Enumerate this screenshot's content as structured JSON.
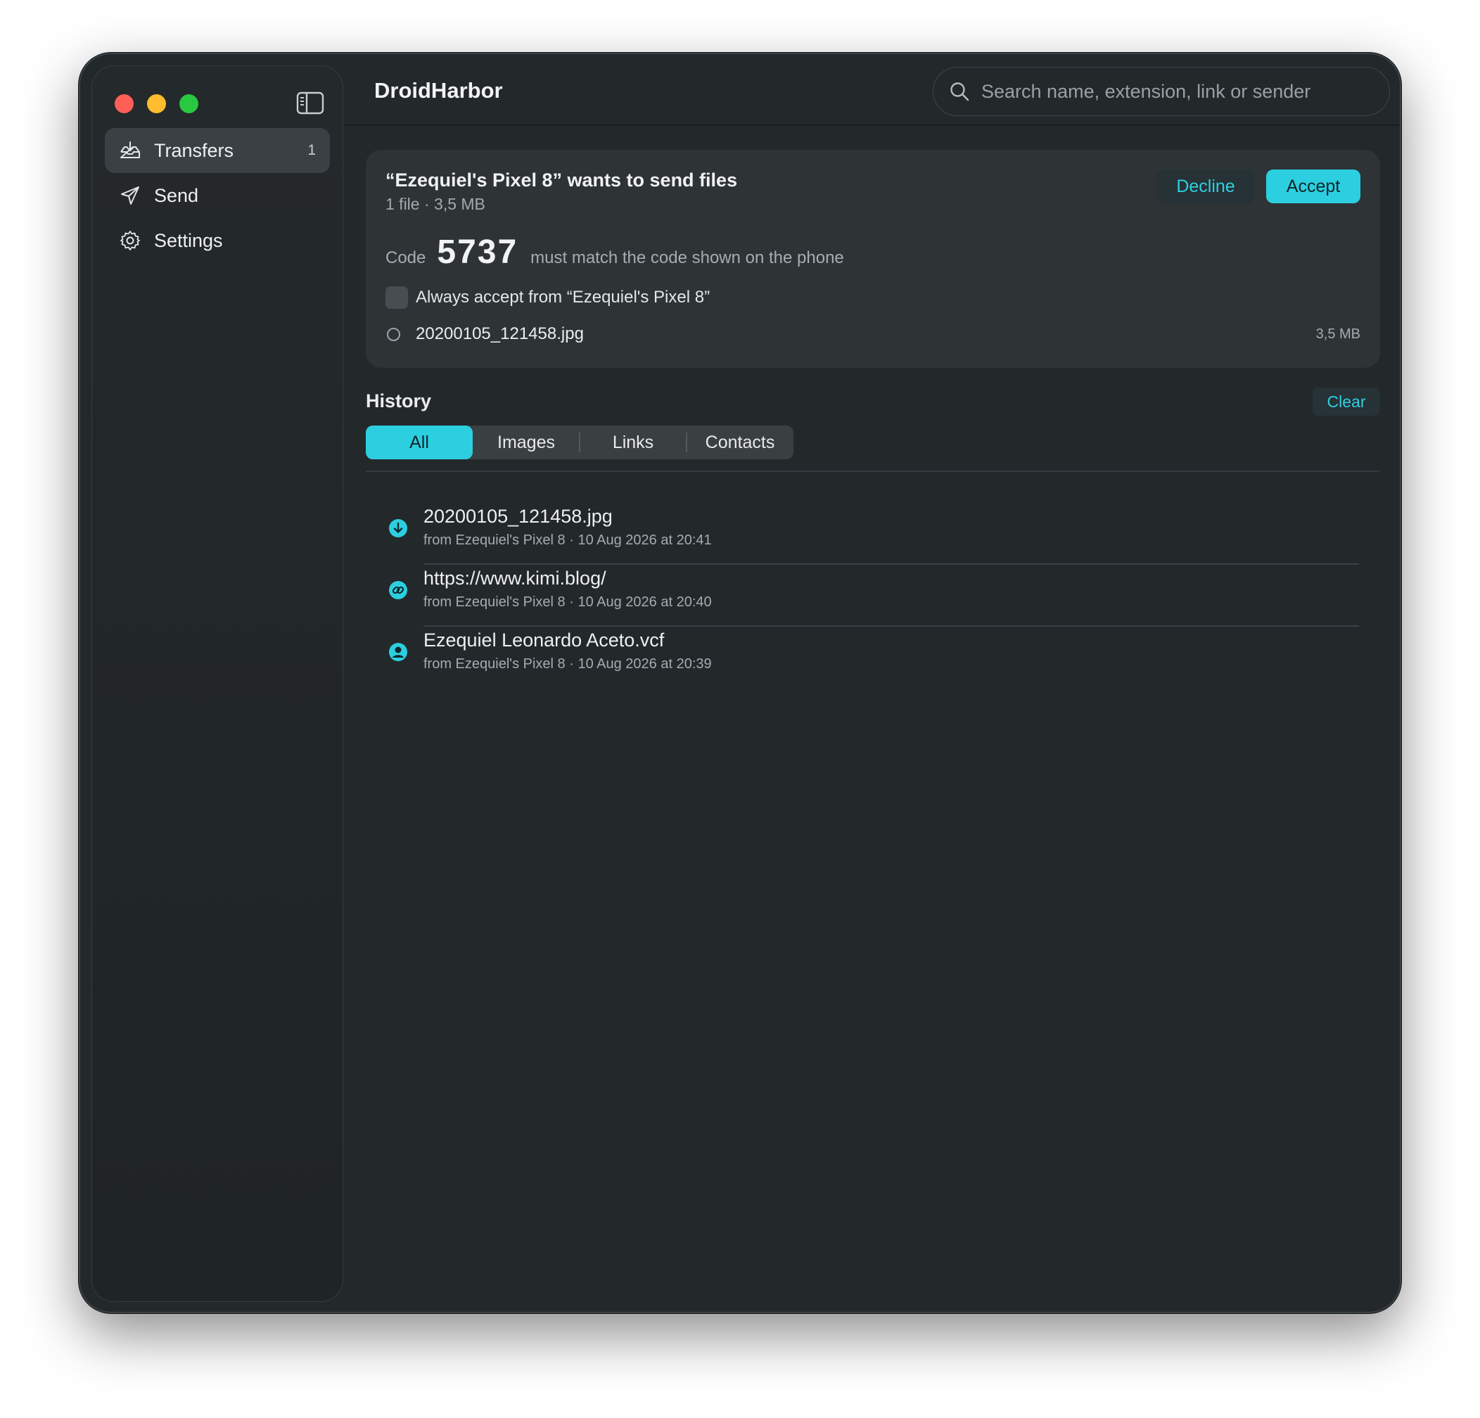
{
  "app": {
    "title": "DroidHarbor"
  },
  "search": {
    "placeholder": "Search name, extension, link or sender"
  },
  "sidebar": {
    "items": [
      {
        "label": "Transfers",
        "icon": "tray-icon",
        "badge": "1",
        "active": true
      },
      {
        "label": "Send",
        "icon": "paper-plane-icon",
        "badge": "",
        "active": false
      },
      {
        "label": "Settings",
        "icon": "gear-icon",
        "badge": "",
        "active": false
      }
    ]
  },
  "request": {
    "title": "“Ezequiel's Pixel 8” wants to send files",
    "subtitle": "1 file · 3,5 MB",
    "decline_label": "Decline",
    "accept_label": "Accept",
    "code_label": "Code",
    "code_value": "5737",
    "code_hint": "must match the code shown on the phone",
    "always_accept_label": "Always accept from “Ezequiel's Pixel 8”",
    "file": {
      "name": "20200105_121458.jpg",
      "size": "3,5 MB"
    }
  },
  "history": {
    "title": "History",
    "clear_label": "Clear",
    "tabs": [
      "All",
      "Images",
      "Links",
      "Contacts"
    ],
    "selected_tab": "All",
    "items": [
      {
        "name": "20200105_121458.jpg",
        "meta": "from Ezequiel's Pixel 8 · 10 Aug 2026 at 20:41",
        "icon": "download-icon"
      },
      {
        "name": "https://www.kimi.blog/",
        "meta": "from Ezequiel's Pixel 8 · 10 Aug 2026 at 20:40",
        "icon": "link-icon"
      },
      {
        "name": "Ezequiel Leonardo Aceto.vcf",
        "meta": "from Ezequiel's Pixel 8 · 10 Aug 2026 at 20:39",
        "icon": "contact-icon"
      }
    ]
  },
  "colors": {
    "accent": "#2ccfe0",
    "window_bg": "#23282b",
    "card_bg": "#2e3336"
  }
}
